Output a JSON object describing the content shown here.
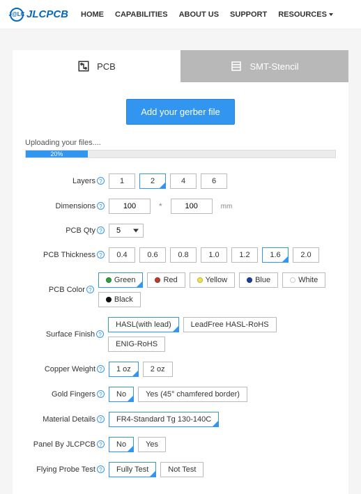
{
  "header": {
    "logo_badge": "J@LC",
    "logo_text": "JLCPCB",
    "nav": [
      "HOME",
      "CAPABILITIES",
      "ABOUT US",
      "SUPPORT",
      "RESOURCES"
    ]
  },
  "tabs": {
    "pcb": "PCB",
    "stencil": "SMT-Stencil"
  },
  "upload": {
    "button": "Add your gerber file",
    "status": "Uploading your files....",
    "percent": "20%"
  },
  "labels": {
    "layers": "Layers",
    "dimensions": "Dimensions",
    "qty": "PCB Qty",
    "thickness": "PCB Thickness",
    "color": "PCB Color",
    "surface": "Surface Finish",
    "copper": "Copper Weight",
    "gold": "Gold Fingers",
    "material": "Material Details",
    "panel": "Panel By JLCPCB",
    "probe": "Flying Probe Test"
  },
  "layers": [
    "1",
    "2",
    "4",
    "6"
  ],
  "layers_selected": "2",
  "dimensions": {
    "w": "100",
    "h": "100",
    "unit": "mm"
  },
  "qty": "5",
  "thickness": [
    "0.4",
    "0.6",
    "0.8",
    "1.0",
    "1.2",
    "1.6",
    "2.0"
  ],
  "thickness_selected": "1.6",
  "colors": [
    {
      "name": "Green",
      "hex": "#2e9e3f"
    },
    {
      "name": "Red",
      "hex": "#c0392b"
    },
    {
      "name": "Yellow",
      "hex": "#f1e24a"
    },
    {
      "name": "Blue",
      "hex": "#1b3f9c"
    },
    {
      "name": "White",
      "hex": "#ffffff"
    },
    {
      "name": "Black",
      "hex": "#111111"
    }
  ],
  "color_selected": "Green",
  "surface": [
    "HASL(with lead)",
    "LeadFree HASL-RoHS",
    "ENIG-RoHS"
  ],
  "surface_selected": "HASL(with lead)",
  "copper": [
    "1 oz",
    "2 oz"
  ],
  "copper_selected": "1 oz",
  "gold": [
    "No",
    "Yes (45° chamfered border)"
  ],
  "gold_selected": "No",
  "material": [
    "FR4-Standard Tg 130-140C"
  ],
  "material_selected": "FR4-Standard Tg 130-140C",
  "panel": [
    "No",
    "Yes"
  ],
  "panel_selected": "No",
  "probe": [
    "Fully Test",
    "Not Test"
  ],
  "probe_selected": "Fully Test"
}
